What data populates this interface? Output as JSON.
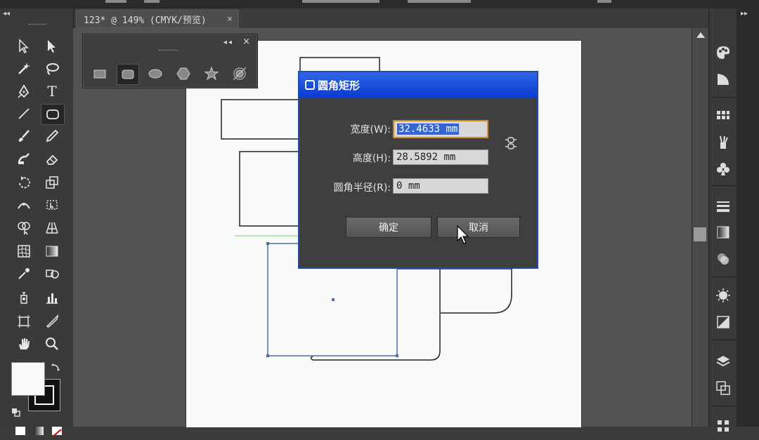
{
  "document": {
    "tab_title": "123* @ 149% (CMYK/预览)",
    "close_glyph": "×"
  },
  "shape_flyout": {
    "collapse_glyph": "◂◂",
    "close_glyph": "×",
    "shapes": [
      "rectangle-icon",
      "rounded-rectangle-icon",
      "ellipse-icon",
      "polygon-icon",
      "star-icon",
      "flare-icon"
    ]
  },
  "dialog": {
    "title": "圆角矩形",
    "width_label": "宽度(W):",
    "width_value": "32.4633 mm",
    "height_label": "高度(H):",
    "height_value": "28.5892 mm",
    "radius_label": "圆角半径(R):",
    "radius_value": "0 mm",
    "ok_label": "确定",
    "cancel_label": "取消"
  },
  "toolbar": {
    "collapse_glyph": "◂◂",
    "type_tool_glyph": "T"
  },
  "rightstrip": {
    "collapse_glyph": "▸▸"
  },
  "colors": {
    "dialog_title": "#0b3ad0",
    "selection_path": "#4a6bb0",
    "accent_highlight": "#3465d8"
  }
}
